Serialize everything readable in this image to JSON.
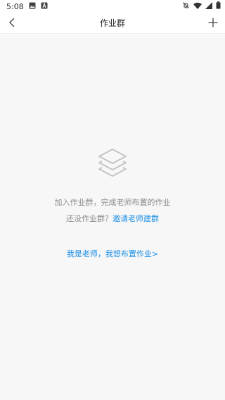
{
  "status_bar": {
    "time": "5:08",
    "icons_left": [
      "image-icon",
      "notification-a-icon"
    ],
    "icons_right": [
      "bell-off-icon",
      "wifi-icon",
      "signal-icon",
      "battery-icon"
    ]
  },
  "header": {
    "title": "作业群",
    "back_icon": "chevron-left-icon",
    "add_icon": "plus-icon"
  },
  "empty_state": {
    "icon": "layers-icon",
    "message": "加入作业群，完成老师布置的作业",
    "invite_prefix": "还没作业群？",
    "invite_link": "邀请老师建群",
    "teacher_link": "我是老师，我想布置作业>"
  },
  "colors": {
    "accent": "#1a8ee6",
    "muted_text": "#8a8a8a",
    "content_bg": "#f7f7f7"
  }
}
